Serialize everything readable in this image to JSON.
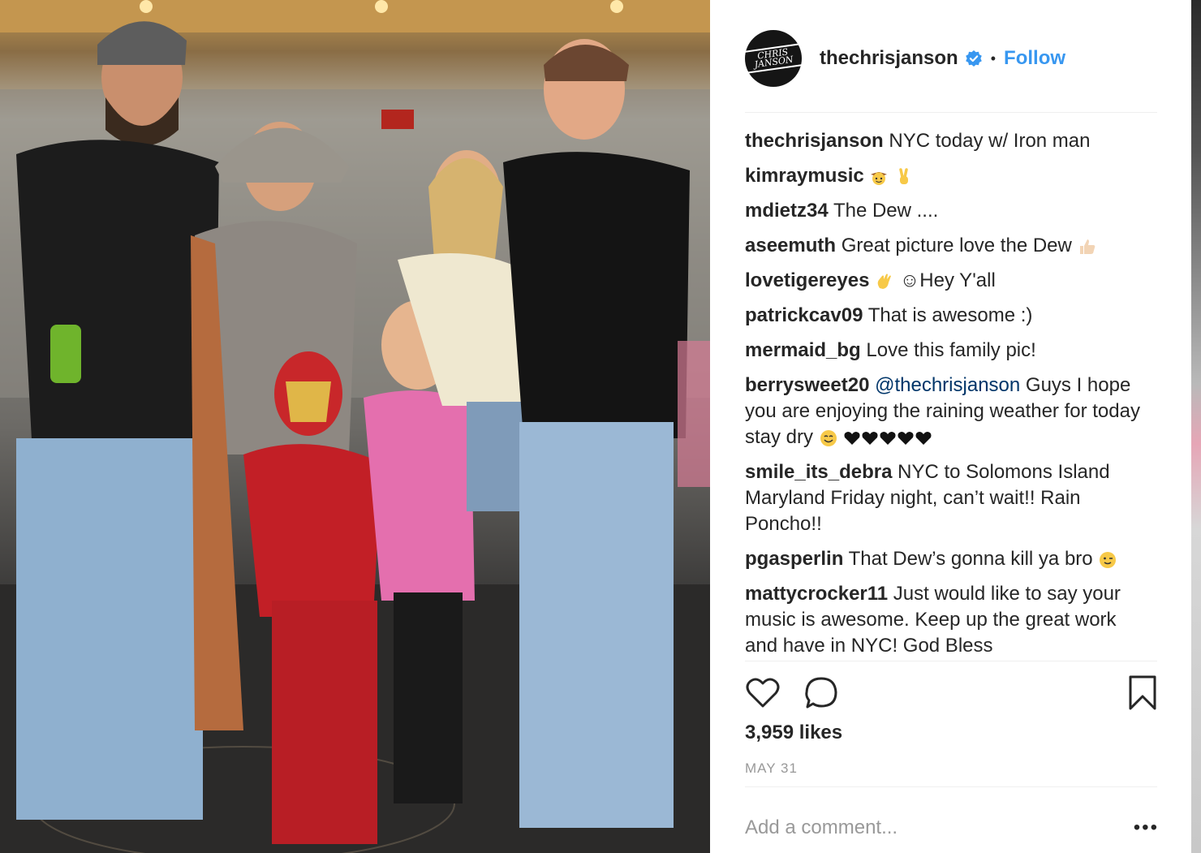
{
  "post": {
    "photo_description_icon": "family-photo-image",
    "username": "thechrisjanson",
    "avatar_text": "CHRIS JANSON",
    "verified_icon": "verified-badge-icon",
    "separator": "•",
    "follow_label": "Follow",
    "colors": {
      "link": "#3897f0",
      "mention": "#003569",
      "muted": "#999999",
      "text": "#262626"
    }
  },
  "comments": [
    {
      "user": "thechrisjanson",
      "text": "NYC today w/ Iron man"
    },
    {
      "user": "kimraymusic",
      "text": "",
      "emoji": [
        "cowboy-face-icon",
        "victory-hand-icon"
      ]
    },
    {
      "user": "mdietz34",
      "text": "The Dew ...."
    },
    {
      "user": "aseemuth",
      "text": "Great picture love the Dew",
      "emoji": [
        "thumbs-up-icon"
      ]
    },
    {
      "user": "lovetigereyes",
      "text": "☺Hey Y'all",
      "emoji_before": [
        "waving-hand-icon"
      ]
    },
    {
      "user": "patrickcav09",
      "text": "That is awesome :)"
    },
    {
      "user": "mermaid_bg",
      "text": "Love this family pic!"
    },
    {
      "user": "berrysweet20",
      "mention": "@thechrisjanson",
      "text": "Guys I hope you are enjoying the raining weather for today stay dry",
      "emoji": [
        "smiling-face-icon",
        "hearts-icon"
      ]
    },
    {
      "user": "smile_its_debra",
      "text": "NYC to Solomons Island Maryland Friday night, can’t wait!! Rain Poncho!!"
    },
    {
      "user": "pgasperlin",
      "text": "That Dew’s gonna kill ya bro",
      "emoji": [
        "winking-face-icon"
      ]
    },
    {
      "user": "mattycrocker11",
      "text": "Just would like to say your music is awesome. Keep up the great work and have in NYC! God Bless"
    }
  ],
  "actions": {
    "like_icon": "heart-icon",
    "comment_icon": "comment-bubble-icon",
    "save_icon": "bookmark-icon"
  },
  "likes": "3,959 likes",
  "date": "MAY 31",
  "add_comment": {
    "placeholder": "Add a comment...",
    "more_label": "•••"
  }
}
